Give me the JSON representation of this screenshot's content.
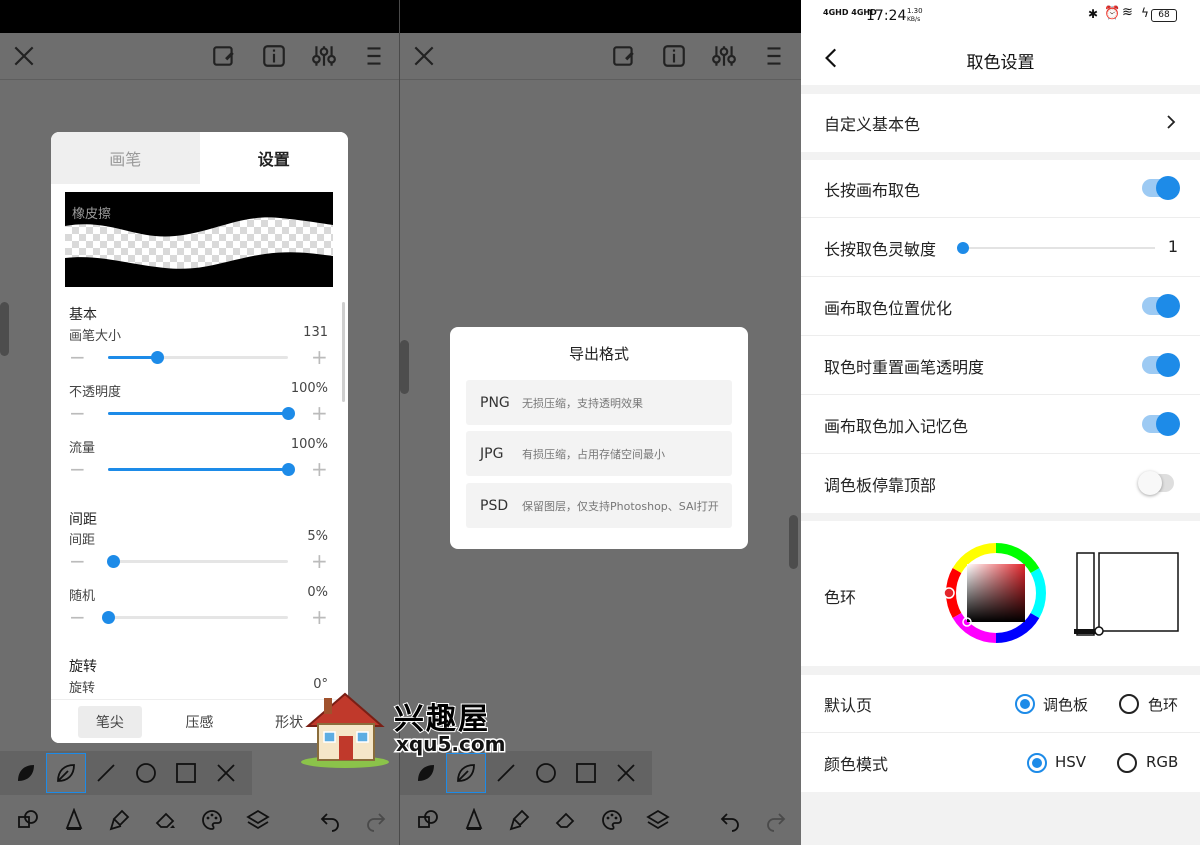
{
  "brush_panel": {
    "tabs": [
      "画笔",
      "设置"
    ],
    "preview_label": "橡皮擦",
    "section_basic": "基本",
    "brush_size": {
      "label": "画笔大小",
      "value": "131",
      "fraction": 0.27
    },
    "opacity": {
      "label": "不透明度",
      "value": "100%",
      "fraction": 1.0
    },
    "flow": {
      "label": "流量",
      "value": "100%",
      "fraction": 1.0
    },
    "section_spacing": "间距",
    "spacing": {
      "label": "间距",
      "value": "5%",
      "fraction": 0.03
    },
    "random": {
      "label": "随机",
      "value": "0%",
      "fraction": 0.0
    },
    "section_rotation": "旋转",
    "rotation": {
      "label": "旋转",
      "value": "0°"
    },
    "bottom_tabs": [
      "笔尖",
      "压感",
      "形状"
    ],
    "minus": "−",
    "plus": "+"
  },
  "export_dialog": {
    "title": "导出格式",
    "options": [
      {
        "name": "PNG",
        "desc": "无损压缩，支持透明效果"
      },
      {
        "name": "JPG",
        "desc": "有损压缩，占用存储空间最小"
      },
      {
        "name": "PSD",
        "desc": "保留图层，仅支持Photoshop、SAI打开"
      }
    ]
  },
  "settings": {
    "status_time": "17:24",
    "status_speed": "1.30",
    "status_speed_unit": "KB/s",
    "status_network": "4GHD 4GHD",
    "status_battery": "68",
    "title": "取色设置",
    "custom_base_color": "自定义基本色",
    "long_press_pick": {
      "label": "长按画布取色",
      "on": true
    },
    "sensitivity": {
      "label": "长按取色灵敏度",
      "value": "1"
    },
    "position_opt": {
      "label": "画布取色位置优化",
      "on": true
    },
    "reset_opacity": {
      "label": "取色时重置画笔透明度",
      "on": true
    },
    "add_memory": {
      "label": "画布取色加入记忆色",
      "on": true
    },
    "palette_top": {
      "label": "调色板停靠顶部",
      "on": false
    },
    "color_wheel_label": "色环",
    "default_page": {
      "label": "默认页",
      "options": [
        "调色板",
        "色环"
      ],
      "selected": 0
    },
    "color_mode": {
      "label": "颜色模式",
      "options": [
        "HSV",
        "RGB"
      ],
      "selected": 0
    }
  },
  "watermark": {
    "name": "兴趣屋",
    "url": "xqu5.com"
  },
  "colors": {
    "accent": "#1d8be8",
    "canvas": "#6e6e6e"
  }
}
